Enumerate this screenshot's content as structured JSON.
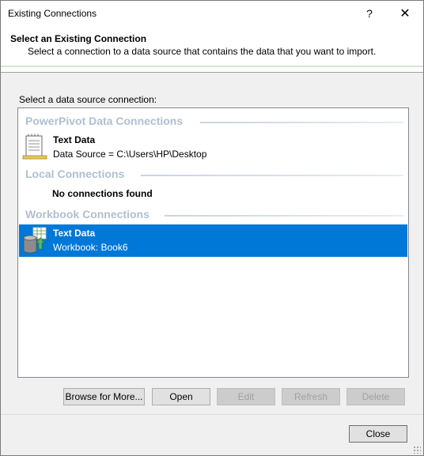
{
  "window": {
    "title": "Existing Connections"
  },
  "titlebar": {
    "help_glyph": "?",
    "close_glyph": "✕"
  },
  "header": {
    "title": "Select an Existing Connection",
    "subtitle": "Select a connection to a data source that contains the data that you want to import."
  },
  "main": {
    "source_label": "Select a data source connection:",
    "groups": [
      {
        "label": "PowerPivot Data Connections",
        "items": [
          {
            "title": "Text Data",
            "subtitle": "Data Source = C:\\Users\\HP\\Desktop",
            "icon": "text-file-icon",
            "selected": false
          }
        ]
      },
      {
        "label": "Local Connections",
        "empty_message": "No connections found"
      },
      {
        "label": "Workbook Connections",
        "items": [
          {
            "title": "Text Data",
            "subtitle": "Workbook: Book6",
            "icon": "workbook-connection-icon",
            "selected": true
          }
        ]
      }
    ]
  },
  "buttons": {
    "browse": "Browse for More...",
    "open": "Open",
    "edit": "Edit",
    "refresh": "Refresh",
    "delete": "Delete",
    "close": "Close"
  },
  "colors": {
    "selection": "#0078d7",
    "group_label": "#b0bfd0",
    "disabled_text": "#a0a0a0"
  }
}
